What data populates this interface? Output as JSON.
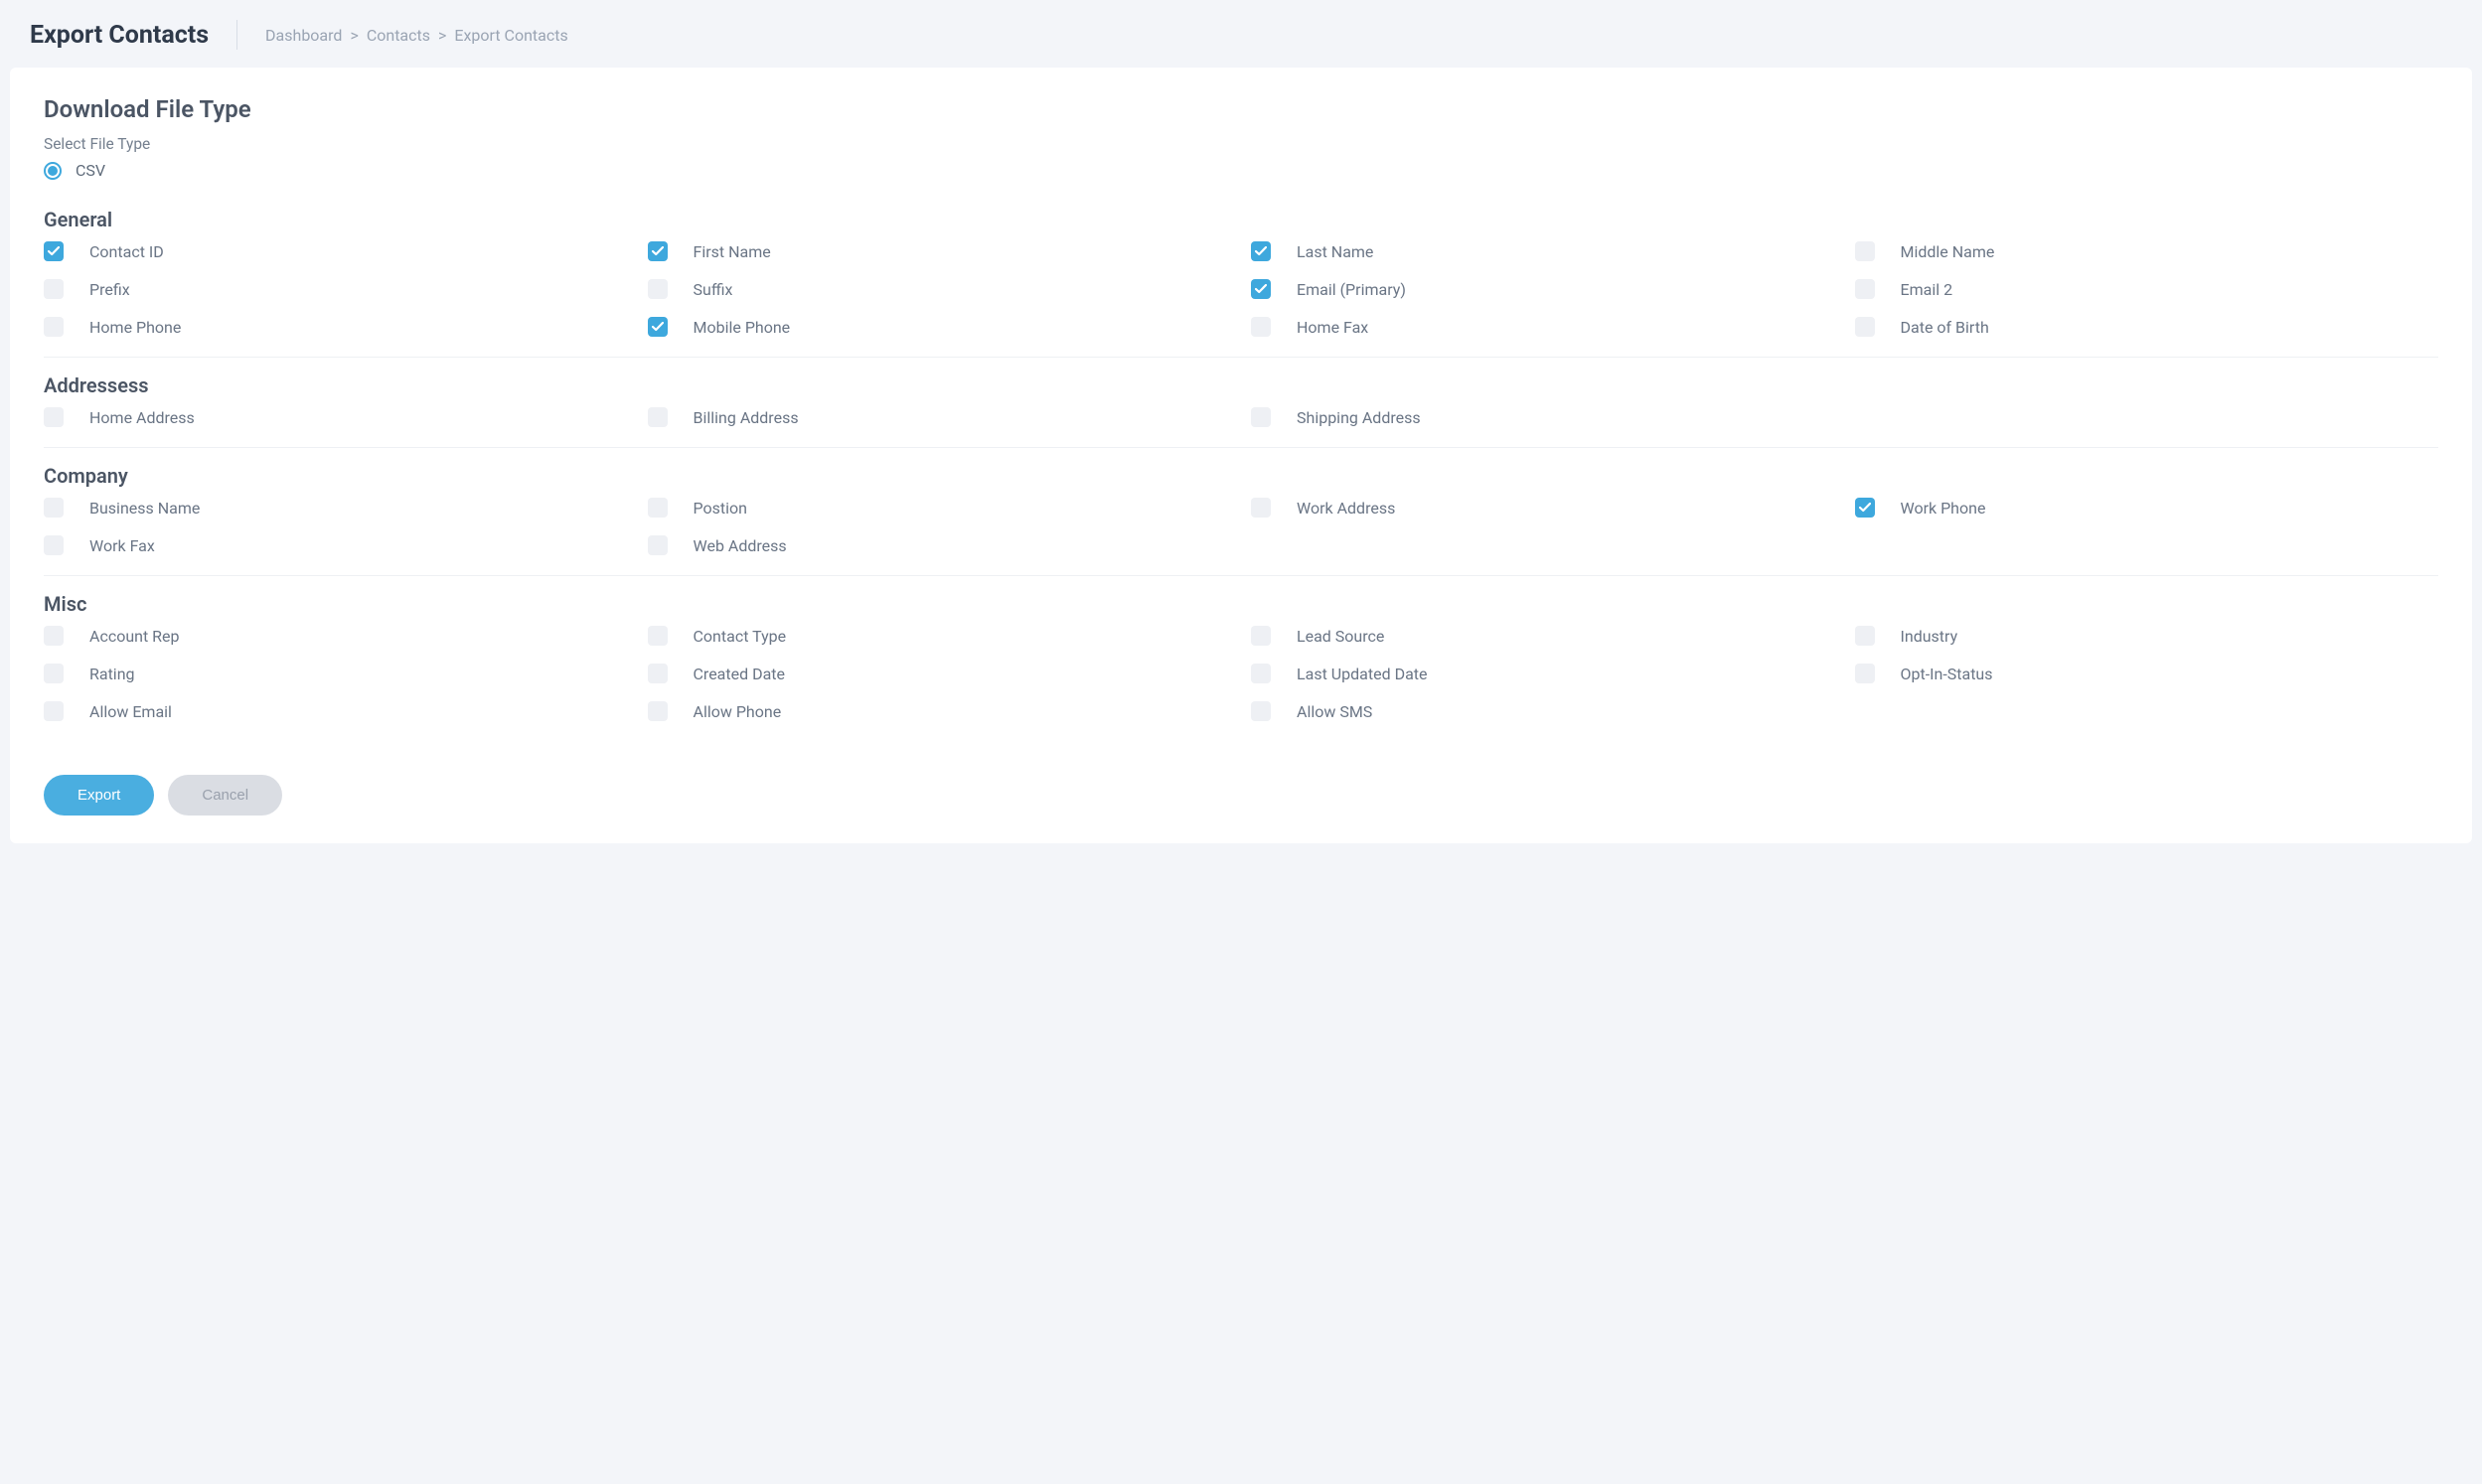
{
  "header": {
    "title": "Export Contacts",
    "breadcrumb": {
      "items": [
        "Dashboard",
        "Contacts",
        "Export Contacts"
      ],
      "sep": ">"
    }
  },
  "card": {
    "download_title": "Download File Type",
    "select_label": "Select File Type",
    "file_type_option": "CSV"
  },
  "groups": [
    {
      "name": "general",
      "title": "General",
      "border": true,
      "items": [
        {
          "label": "Contact ID",
          "checked": true
        },
        {
          "label": "First Name",
          "checked": true
        },
        {
          "label": "Last Name",
          "checked": true
        },
        {
          "label": "Middle Name",
          "checked": false
        },
        {
          "label": "Prefix",
          "checked": false
        },
        {
          "label": "Suffix",
          "checked": false
        },
        {
          "label": "Email (Primary)",
          "checked": true
        },
        {
          "label": "Email 2",
          "checked": false
        },
        {
          "label": "Home Phone",
          "checked": false
        },
        {
          "label": "Mobile Phone",
          "checked": true
        },
        {
          "label": "Home Fax",
          "checked": false
        },
        {
          "label": "Date of Birth",
          "checked": false
        }
      ]
    },
    {
      "name": "addresses",
      "title": "Addressess",
      "border": true,
      "items": [
        {
          "label": "Home Address",
          "checked": false
        },
        {
          "label": "Billing Address",
          "checked": false
        },
        {
          "label": "Shipping Address",
          "checked": false
        }
      ]
    },
    {
      "name": "company",
      "title": "Company",
      "border": true,
      "items": [
        {
          "label": "Business Name",
          "checked": false
        },
        {
          "label": "Postion",
          "checked": false
        },
        {
          "label": "Work Address",
          "checked": false
        },
        {
          "label": "Work Phone",
          "checked": true
        },
        {
          "label": "Work Fax",
          "checked": false
        },
        {
          "label": "Web Address",
          "checked": false
        }
      ]
    },
    {
      "name": "misc",
      "title": "Misc",
      "border": false,
      "items": [
        {
          "label": "Account Rep",
          "checked": false
        },
        {
          "label": "Contact Type",
          "checked": false
        },
        {
          "label": "Lead Source",
          "checked": false
        },
        {
          "label": "Industry",
          "checked": false
        },
        {
          "label": "Rating",
          "checked": false
        },
        {
          "label": "Created Date",
          "checked": false
        },
        {
          "label": "Last Updated Date",
          "checked": false
        },
        {
          "label": "Opt-In-Status",
          "checked": false
        },
        {
          "label": "Allow Email",
          "checked": false
        },
        {
          "label": "Allow Phone",
          "checked": false
        },
        {
          "label": "Allow SMS",
          "checked": false
        }
      ]
    }
  ],
  "actions": {
    "export": "Export",
    "cancel": "Cancel"
  }
}
